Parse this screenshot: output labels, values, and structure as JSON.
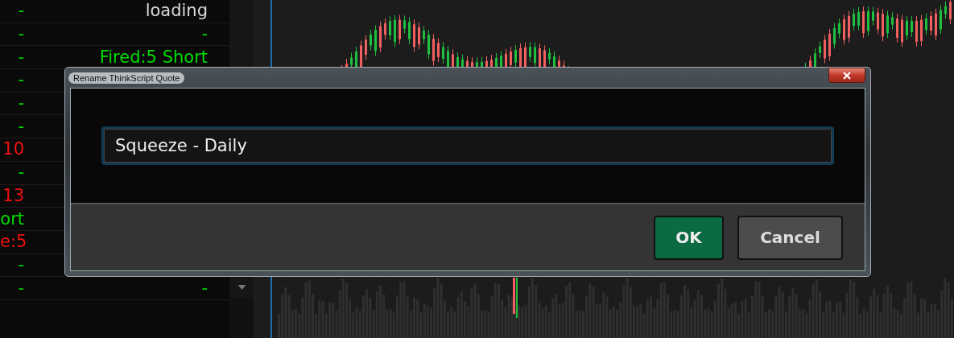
{
  "watchlist": {
    "rows": [
      {
        "left": {
          "text": "-",
          "color": "#00dd00"
        },
        "right": {
          "text": "loading",
          "color": "#d8d8d8"
        }
      },
      {
        "left": {
          "text": "-",
          "color": "#00dd00"
        },
        "right": {
          "text": "-",
          "color": "#00dd00"
        }
      },
      {
        "left": {
          "text": "-",
          "color": "#00dd00"
        },
        "right": {
          "text": "Fired:5 Short",
          "color": "#00dd00"
        }
      },
      {
        "left": {
          "text": "-",
          "color": "#00dd00"
        }
      },
      {
        "left": {
          "text": "-",
          "color": "#00dd00"
        }
      },
      {
        "left": {
          "text": "-",
          "color": "#00dd00"
        }
      },
      {
        "left": {
          "text": "10",
          "color": "#ee1111"
        }
      },
      {
        "left": {
          "text": "-",
          "color": "#00dd00"
        }
      },
      {
        "left": {
          "text": "13",
          "color": "#ee1111"
        }
      },
      {
        "left": {
          "text": "ort",
          "color": "#00dd00"
        }
      },
      {
        "left": {
          "text": "e:5",
          "color": "#ee1111"
        }
      },
      {
        "left": {
          "text": "-",
          "color": "#00dd00"
        }
      },
      {
        "left": {
          "text": "-",
          "color": "#00dd00"
        },
        "right": {
          "text": "-",
          "color": "#00dd00"
        }
      }
    ]
  },
  "dialog": {
    "title": "Rename ThinkScript Quote",
    "name_field": {
      "value": "Squeeze - Daily"
    },
    "buttons": [
      {
        "label": "OK",
        "kind": "primary"
      },
      {
        "label": "Cancel",
        "kind": "secondary"
      }
    ]
  }
}
